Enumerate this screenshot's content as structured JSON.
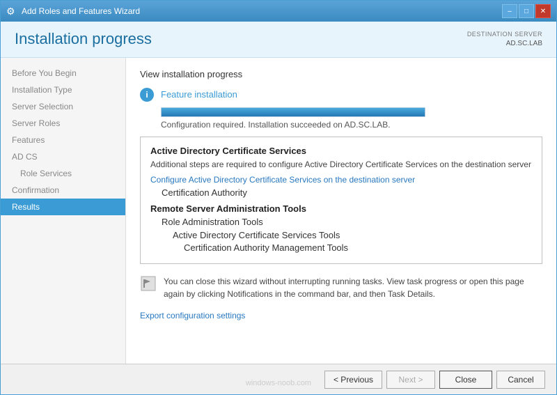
{
  "window": {
    "title": "Add Roles and Features Wizard",
    "icon": "⚙"
  },
  "titlebar": {
    "minimize": "–",
    "maximize": "□",
    "close": "✕"
  },
  "header": {
    "title": "Installation progress",
    "destination_label": "DESTINATION SERVER",
    "destination_value": "AD.SC.LAB"
  },
  "sidebar": {
    "items": [
      {
        "label": "Before You Begin",
        "state": "inactive",
        "sub": false
      },
      {
        "label": "Installation Type",
        "state": "inactive",
        "sub": false
      },
      {
        "label": "Server Selection",
        "state": "inactive",
        "sub": false
      },
      {
        "label": "Server Roles",
        "state": "inactive",
        "sub": false
      },
      {
        "label": "Features",
        "state": "inactive",
        "sub": false
      },
      {
        "label": "AD CS",
        "state": "inactive",
        "sub": false
      },
      {
        "label": "Role Services",
        "state": "inactive",
        "sub": true
      },
      {
        "label": "Confirmation",
        "state": "inactive",
        "sub": false
      },
      {
        "label": "Results",
        "state": "active",
        "sub": false
      }
    ]
  },
  "content": {
    "view_progress_label": "View installation progress",
    "feature_install_label": "Feature installation",
    "config_status": "Configuration required. Installation succeeded on AD.SC.LAB.",
    "progress_percent": 100,
    "results_box": {
      "section1_title": "Active Directory Certificate Services",
      "section1_desc": "Additional steps are required to configure Active Directory Certificate Services on the destination server",
      "section1_link": "Configure Active Directory Certificate Services on the destination server",
      "section1_sub": "Certification Authority",
      "section2_title": "Remote Server Administration Tools",
      "section2_sub1": "Role Administration Tools",
      "section2_sub2": "Active Directory Certificate Services Tools",
      "section2_sub3": "Certification Authority Management Tools"
    },
    "notification_text": "You can close this wizard without interrupting running tasks. View task progress or open this page again by clicking Notifications in the command bar, and then Task Details.",
    "export_link": "Export configuration settings"
  },
  "footer": {
    "previous": "< Previous",
    "next": "Next >",
    "close": "Close",
    "cancel": "Cancel",
    "watermark": "windows-noob.com"
  }
}
